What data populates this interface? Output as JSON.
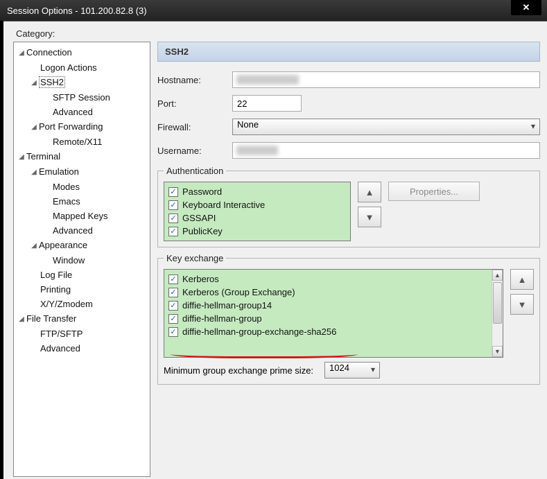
{
  "titlebar": {
    "title": "Session Options - 101.200.82.8 (3)"
  },
  "category_label": "Category:",
  "tree": {
    "connection": "Connection",
    "logon_actions": "Logon Actions",
    "ssh2": "SSH2",
    "sftp_session": "SFTP Session",
    "ssh2_advanced": "Advanced",
    "port_forwarding": "Port Forwarding",
    "remote_x11": "Remote/X11",
    "terminal": "Terminal",
    "emulation": "Emulation",
    "modes": "Modes",
    "emacs": "Emacs",
    "mapped_keys": "Mapped Keys",
    "emu_advanced": "Advanced",
    "appearance": "Appearance",
    "window": "Window",
    "log_file": "Log File",
    "printing": "Printing",
    "xyz": "X/Y/Zmodem",
    "file_transfer": "File Transfer",
    "ftp_sftp": "FTP/SFTP",
    "ft_advanced": "Advanced"
  },
  "section_header": "SSH2",
  "labels": {
    "hostname": "Hostname:",
    "port": "Port:",
    "firewall": "Firewall:",
    "username": "Username:",
    "auth_legend": "Authentication",
    "kex_legend": "Key exchange",
    "properties": "Properties...",
    "min_prime": "Minimum group exchange prime size:"
  },
  "values": {
    "hostname": "",
    "port": "22",
    "firewall": "None",
    "username": "",
    "prime_size": "1024"
  },
  "auth_items": [
    {
      "label": "Password",
      "checked": true
    },
    {
      "label": "Keyboard Interactive",
      "checked": true
    },
    {
      "label": "GSSAPI",
      "checked": true
    },
    {
      "label": "PublicKey",
      "checked": true
    }
  ],
  "kex_items": [
    {
      "label": "Kerberos",
      "checked": true
    },
    {
      "label": "Kerberos (Group Exchange)",
      "checked": true
    },
    {
      "label": "diffie-hellman-group14",
      "checked": true
    },
    {
      "label": "diffie-hellman-group",
      "checked": true
    },
    {
      "label": "diffie-hellman-group-exchange-sha256",
      "checked": true
    }
  ]
}
